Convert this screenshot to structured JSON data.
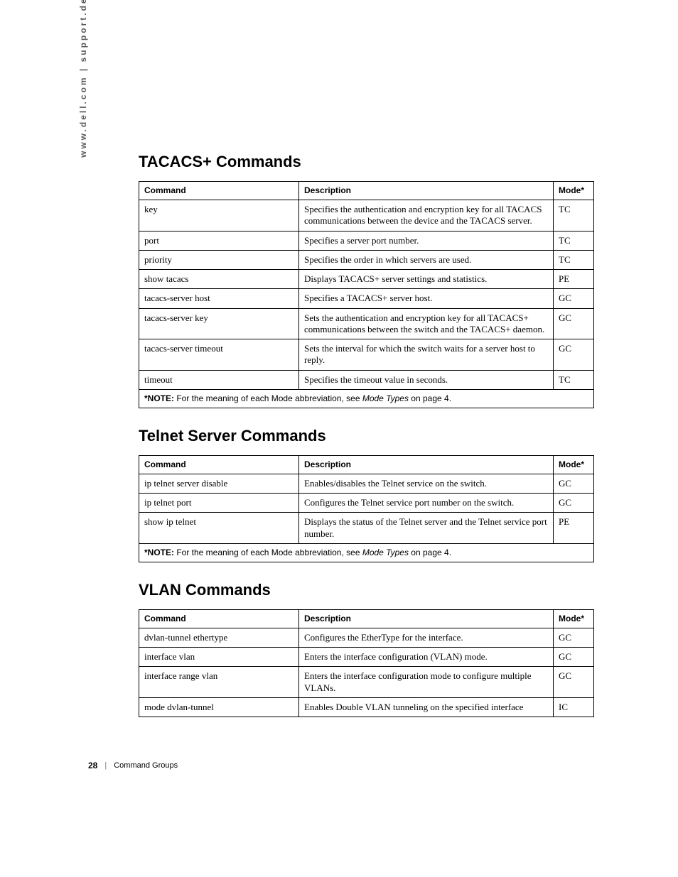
{
  "side_text": "www.dell.com | support.dell.com",
  "sections": [
    {
      "title": "TACACS+ Commands",
      "headers": {
        "command": "Command",
        "description": "Description",
        "mode": "Mode*"
      },
      "rows": [
        {
          "command": "key",
          "description": "Specifies the authentication and encryption key for all TACACS communications between the device and the TACACS server.",
          "mode": "TC"
        },
        {
          "command": "port",
          "description": "Specifies a server port number.",
          "mode": "TC"
        },
        {
          "command": "priority",
          "description": "Specifies the order in which servers are used.",
          "mode": "TC"
        },
        {
          "command": "show tacacs",
          "description": "Displays TACACS+ server settings and statistics.",
          "mode": "PE"
        },
        {
          "command": "tacacs-server host",
          "description": "Specifies a TACACS+ server host.",
          "mode": "GC"
        },
        {
          "command": "tacacs-server key",
          "description": "Sets the authentication and encryption key for all TACACS+ communications between the switch and the TACACS+ daemon.",
          "mode": "GC"
        },
        {
          "command": "tacacs-server timeout",
          "description": "Sets the interval for which the switch waits for a server host to reply.",
          "mode": "GC"
        },
        {
          "command": "timeout",
          "description": "Specifies the timeout value in seconds.",
          "mode": "TC"
        }
      ],
      "note": {
        "bold": "*NOTE:",
        "text_before": " For the meaning of each Mode abbreviation, see ",
        "italic": "Mode Types",
        "text_after": " on page 4."
      }
    },
    {
      "title": "Telnet Server Commands",
      "headers": {
        "command": "Command",
        "description": "Description",
        "mode": "Mode*"
      },
      "rows": [
        {
          "command": "ip telnet server disable",
          "description": "Enables/disables the Telnet service on the switch.",
          "mode": "GC"
        },
        {
          "command": "ip telnet port",
          "description": "Configures the Telnet service port number on the switch.",
          "mode": "GC"
        },
        {
          "command": "show ip telnet",
          "description": "Displays the status of the Telnet server and the Telnet service port number.",
          "mode": "PE"
        }
      ],
      "note": {
        "bold": "*NOTE:",
        "text_before": " For the meaning of each Mode abbreviation, see ",
        "italic": "Mode Types",
        "text_after": " on page 4."
      }
    },
    {
      "title": "VLAN Commands",
      "headers": {
        "command": "Command",
        "description": "Description",
        "mode": "Mode*"
      },
      "rows": [
        {
          "command": "dvlan-tunnel ethertype",
          "description": "Configures the EtherType for the interface.",
          "mode": "GC"
        },
        {
          "command": "interface vlan",
          "description": "Enters the interface configuration (VLAN) mode.",
          "mode": "GC"
        },
        {
          "command": "interface range vlan",
          "description": "Enters the interface configuration mode to configure multiple VLANs.",
          "mode": "GC"
        },
        {
          "command": "mode dvlan-tunnel",
          "description": "Enables Double VLAN tunneling on the specified interface",
          "mode": "IC"
        }
      ]
    }
  ],
  "footer": {
    "page_number": "28",
    "divider": "|",
    "section_name": "Command Groups"
  }
}
